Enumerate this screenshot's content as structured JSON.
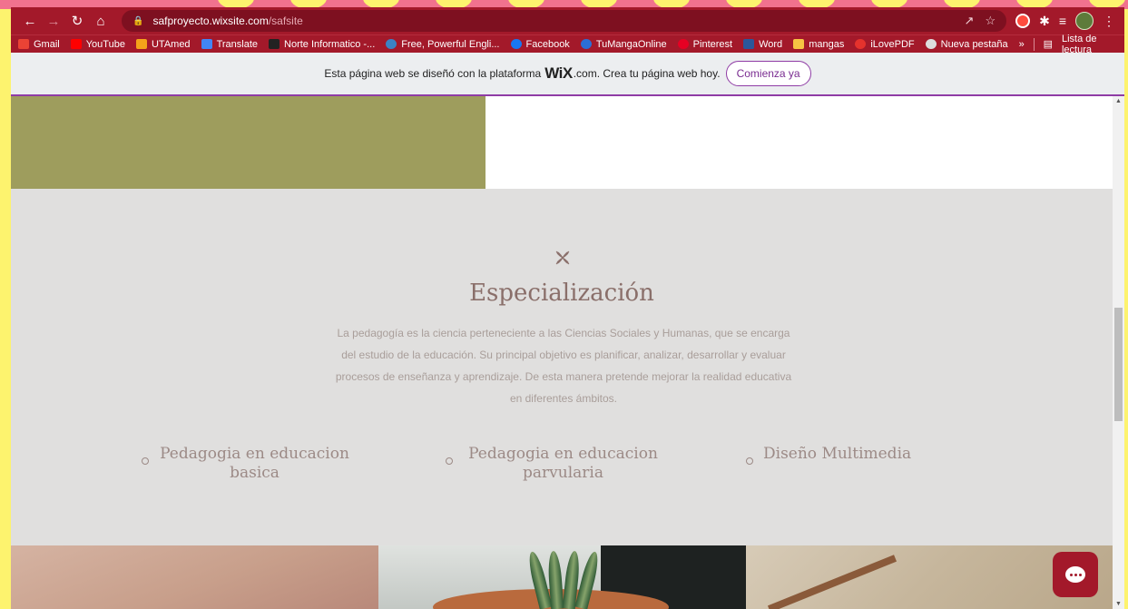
{
  "browser": {
    "url_host": "safproyecto.wixsite.com",
    "url_path": "/safsite"
  },
  "bookmarks": [
    {
      "label": "Gmail",
      "color": "#ea4335"
    },
    {
      "label": "YouTube",
      "color": "#ff0000"
    },
    {
      "label": "UTAmed",
      "color": "#f4a31a"
    },
    {
      "label": "Translate",
      "color": "#4285f4"
    },
    {
      "label": "Norte Informatico -...",
      "color": "#222222"
    },
    {
      "label": "Free, Powerful Engli...",
      "color": "#3b82c4"
    },
    {
      "label": "Facebook",
      "color": "#1877f2"
    },
    {
      "label": "TuMangaOnline",
      "color": "#2c6ed6"
    },
    {
      "label": "Pinterest",
      "color": "#e60023"
    },
    {
      "label": "Word",
      "color": "#2b579a"
    },
    {
      "label": "mangas",
      "color": "#f6c343"
    },
    {
      "label": "iLovePDF",
      "color": "#e5322d"
    },
    {
      "label": "Nueva pestaña",
      "color": "#dddddd"
    }
  ],
  "bookmarks_more": "»",
  "reading_list": "Lista de lectura",
  "wix_banner": {
    "text_before": "Esta página web se diseñó con la plataforma",
    "logo": "WiX",
    "text_after": ".com. Crea tu página web hoy.",
    "button": "Comienza ya"
  },
  "specialization": {
    "title": "Especialización",
    "description": "La pedagogía es la ciencia perteneciente a las Ciencias Sociales y Humanas, que se encarga del estudio de la educación. Su principal objetivo es planificar, analizar, desarrollar y evaluar procesos de enseñanza y aprendizaje. De esta manera pretende mejorar la realidad educativa en diferentes ámbitos.",
    "items": [
      "Pedagogia en educacion basica",
      "Pedagogia en educacion parvularia",
      "Diseño Multimedia"
    ]
  },
  "colors": {
    "browser_chrome": "#a3192a",
    "olive_block": "#9e9d5d",
    "section_bg": "#e0dfde",
    "title_color": "#8a6f6a",
    "wix_accent": "#8f3ca5"
  }
}
